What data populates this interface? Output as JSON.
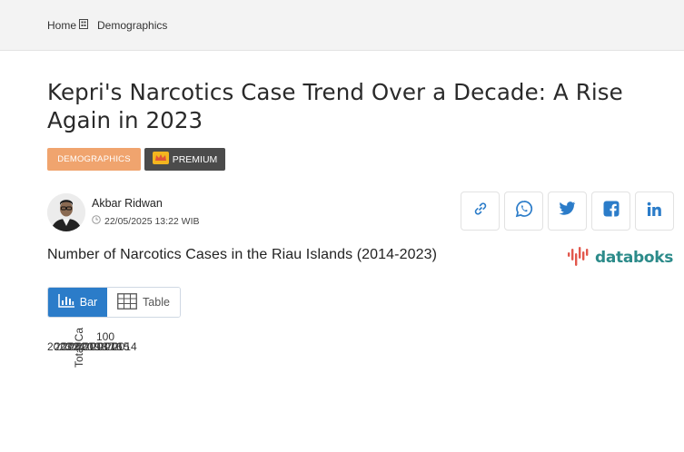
{
  "breadcrumb": {
    "home": "Home",
    "current": "Demographics"
  },
  "article": {
    "title": "Kepri's Narcotics Case Trend Over a Decade: A Rise Again in 2023",
    "category": "DEMOGRAPHICS",
    "premium": "PREMIUM",
    "author": "Akbar Ridwan",
    "date": "22/05/2025 13:22 WIB"
  },
  "share": [
    "link-icon",
    "whatsapp-icon",
    "twitter-icon",
    "facebook-icon",
    "linkedin-icon"
  ],
  "chart_header": {
    "title": "Number of Narcotics Cases in the Riau Islands (2014-2023)",
    "logo": "databoks"
  },
  "toggle": {
    "bar": "Bar",
    "table": "Table"
  },
  "colors": {
    "accent": "#2b7cc9",
    "category_badge": "#f0a46e",
    "premium_badge": "#4b4b4b",
    "logo": "#2c8b8a"
  },
  "chart_data": {
    "type": "bar",
    "categories": [
      "2023",
      "2022",
      "2021",
      "2020",
      "2019",
      "2018",
      "2017",
      "2016",
      "2015",
      "2014"
    ],
    "values": [],
    "ylabel": "Total Ca",
    "yticks": [
      "100"
    ],
    "collapsed": true
  }
}
